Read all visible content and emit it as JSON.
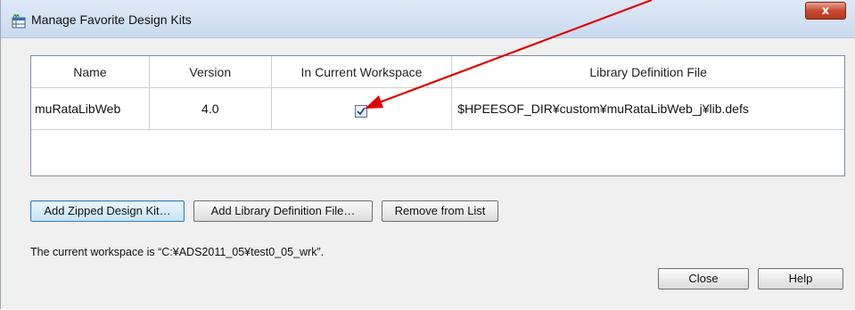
{
  "window": {
    "title": "Manage Favorite Design Kits",
    "close_glyph": "x"
  },
  "table": {
    "headers": [
      "Name",
      "Version",
      "In Current Workspace",
      "Library Definition File"
    ],
    "rows": [
      {
        "name": "muRataLibWeb",
        "version": "4.0",
        "in_current_workspace": true,
        "library_definition_file": "$HPEESOF_DIR¥custom¥muRataLibWeb_j¥lib.defs"
      }
    ]
  },
  "buttons": {
    "add_zipped": "Add Zipped Design Kit…",
    "add_library": "Add Library Definition File…",
    "remove": "Remove from List",
    "close": "Close",
    "help": "Help"
  },
  "status_text": "The current workspace is “C:¥ADS2011_05¥test0_05_wrk”.",
  "annotation": {
    "arrow_color": "#e00000"
  }
}
